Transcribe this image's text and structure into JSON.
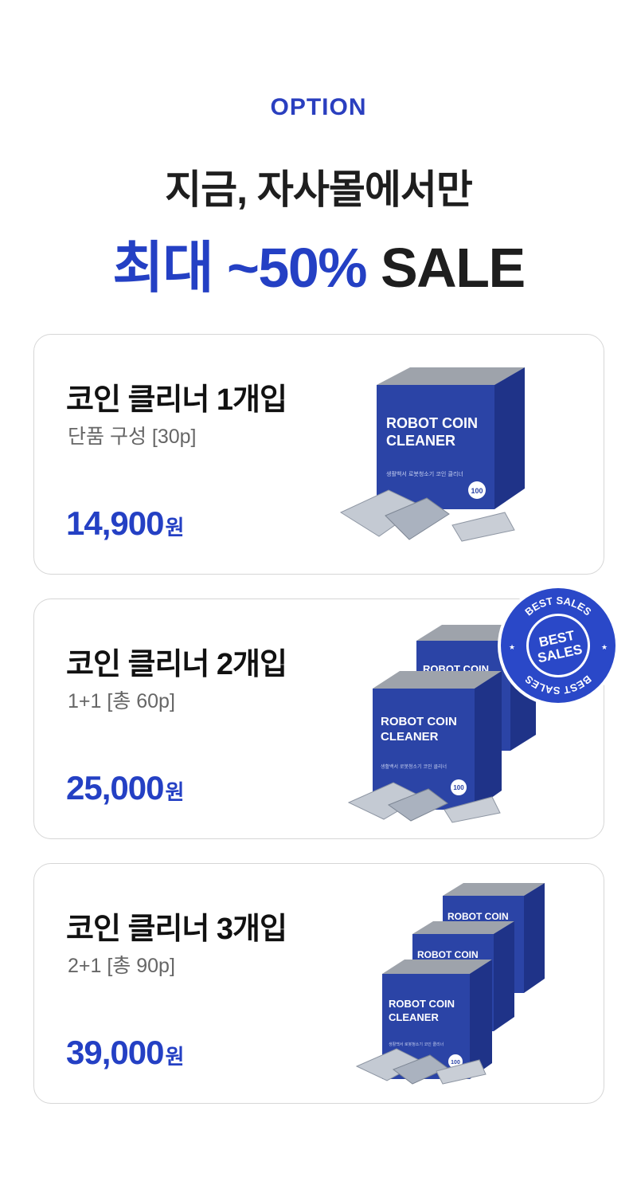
{
  "header": {
    "eyebrow": "OPTION",
    "headline": "지금, 자사몰에서만",
    "sale_accent": "최대 ~50%",
    "sale_rest": "SALE"
  },
  "box_print": {
    "line1": "ROBOT COIN",
    "line2": "CLEANER",
    "line3": "생활백서 로봇청소기 코인 클리너",
    "seal": "100",
    "partial": "ROBOT COIN"
  },
  "options": [
    {
      "title": "코인 클리너 1개입",
      "subtitle": "단품 구성 [30p]",
      "price": "14,900",
      "unit": "원"
    },
    {
      "title": "코인 클리너 2개입",
      "subtitle": "1+1 [총 60p]",
      "price": "25,000",
      "unit": "원"
    },
    {
      "title": "코인 클리너 3개입",
      "subtitle": "2+1 [총 90p]",
      "price": "39,000",
      "unit": "원"
    }
  ],
  "badge": {
    "ring_top": "BEST SALES",
    "center_line1": "BEST",
    "center_line2": "SALES",
    "ring_bottom": "BEST SALES"
  },
  "colors": {
    "accent": "#2440c4",
    "box_blue": "#2b44a6",
    "badge_blue": "#2a48c8"
  }
}
